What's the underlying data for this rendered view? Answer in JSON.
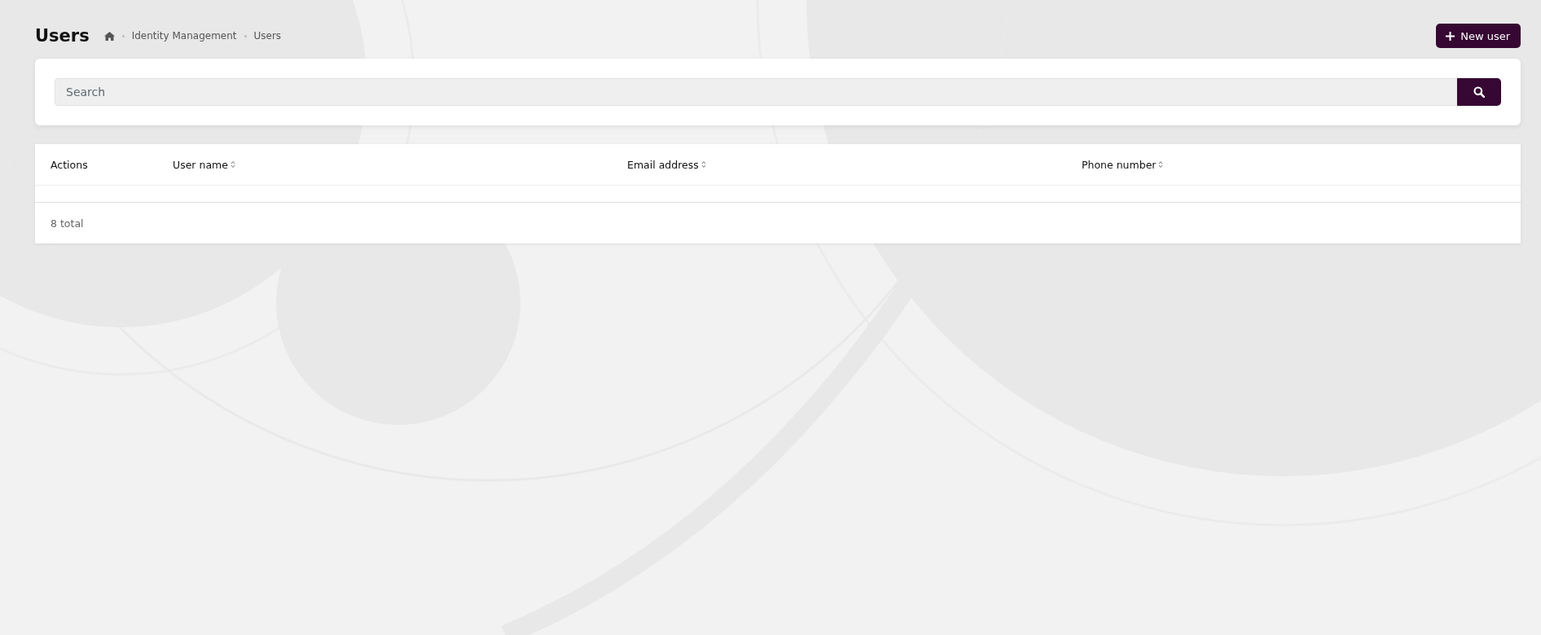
{
  "page": {
    "title": "Users"
  },
  "breadcrumb": [
    {
      "kind": "home"
    },
    {
      "kind": "text",
      "label": "Identity Management"
    },
    {
      "kind": "text",
      "label": "Users"
    }
  ],
  "new_button": {
    "label": "New user"
  },
  "search": {
    "placeholder": "Search"
  },
  "table": {
    "columns": [
      {
        "label": "Actions",
        "sortable": false
      },
      {
        "label": "User name",
        "sortable": true
      },
      {
        "label": "Email address",
        "sortable": true
      },
      {
        "label": "Phone number",
        "sortable": true
      }
    ],
    "footer": "8 total"
  }
}
